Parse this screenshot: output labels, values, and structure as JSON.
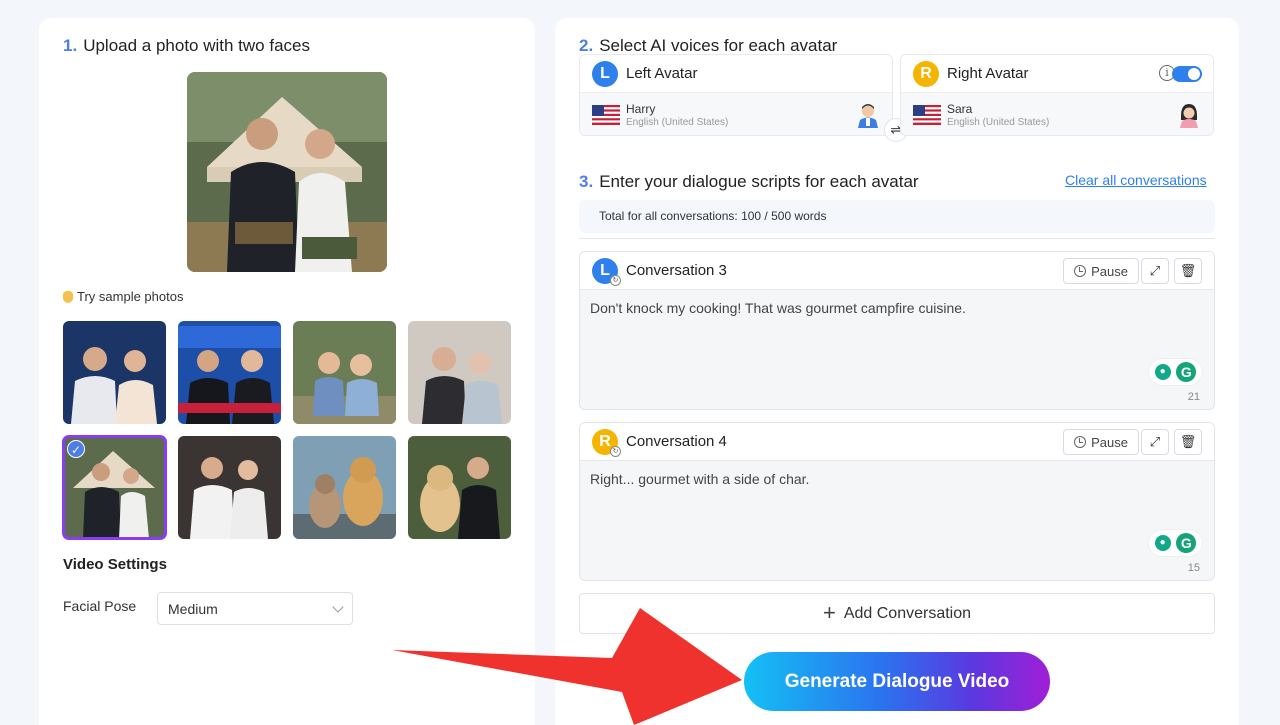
{
  "left": {
    "step_num": "1.",
    "step_title": "Upload a photo with two faces",
    "sample_label": "Try sample photos",
    "video_settings_title": "Video Settings",
    "facial_pose_label": "Facial Pose",
    "facial_pose_value": "Medium"
  },
  "right": {
    "step2_num": "2.",
    "step2_title": "Select AI voices for each avatar",
    "left_avatar": {
      "badge": "L",
      "label": "Left Avatar",
      "voice_name": "Harry",
      "voice_lang": "English (United States)"
    },
    "right_avatar": {
      "badge": "R",
      "label": "Right Avatar",
      "voice_name": "Sara",
      "voice_lang": "English (United States)"
    },
    "swap_symbol": "⇌",
    "step3_num": "3.",
    "step3_title": "Enter your dialogue scripts for each avatar",
    "clear_link": "Clear all conversations",
    "total_text": "Total for all conversations: 100 / 500 words",
    "conversations": [
      {
        "badge": "L",
        "title": "Conversation 3",
        "pause_label": "Pause",
        "text": "Don't knock my cooking! That was gourmet campfire cuisine.",
        "count": "21"
      },
      {
        "badge": "R",
        "title": "Conversation 4",
        "pause_label": "Pause",
        "text": "Right... gourmet with a side of char.",
        "count": "15"
      }
    ],
    "add_conversation": "Add Conversation",
    "generate_button": "Generate Dialogue Video"
  },
  "colors": {
    "accent": "#2f80ed",
    "step_number": "#4f7ee8",
    "right_badge": "#f5b400",
    "selected_outline": "#8a3cf0",
    "arrow": "#f0322e"
  }
}
